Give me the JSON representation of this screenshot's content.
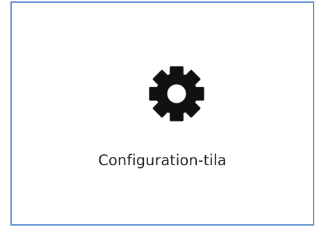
{
  "tile": {
    "label": "Configuration-tila",
    "icon": "gear-icon",
    "border_color": "#5b8fd0",
    "icon_color": "#111111"
  }
}
